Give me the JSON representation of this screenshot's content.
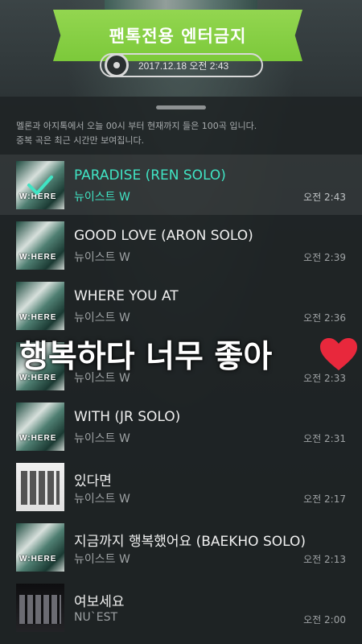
{
  "banner": {
    "label": "팬톡전용 엔터금지"
  },
  "header": {
    "timestamp": "2017.12.18 오전 2:43"
  },
  "notice": {
    "line1": "멜론과 아지톡에서 오늘 00시 부터 현재까지 들은 100곡 입니다.",
    "line2": "중복 곡은 최근 시간만 보여집니다."
  },
  "songs": [
    {
      "title": "PARADISE (REN SOLO)",
      "artist": "뉴이스트 W",
      "time": "오전 2:43",
      "selected": true,
      "art": "where"
    },
    {
      "title": "GOOD LOVE (ARON SOLO)",
      "artist": "뉴이스트 W",
      "time": "오전 2:39",
      "art": "where"
    },
    {
      "title": "WHERE YOU AT",
      "artist": "뉴이스트 W",
      "time": "오전 2:36",
      "art": "where"
    },
    {
      "title": "",
      "artist": "뉴이스트 W",
      "time": "오전 2:33",
      "art": "where"
    },
    {
      "title": "WITH (JR SOLO)",
      "artist": "뉴이스트 W",
      "time": "오전 2:31",
      "art": "where"
    },
    {
      "title": "있다면",
      "artist": "뉴이스트 W",
      "time": "오전 2:17",
      "art": "group"
    },
    {
      "title": "지금까지 행복했어요 (BAEKHO SOLO)",
      "artist": "뉴이스트 W",
      "time": "오전 2:13",
      "art": "where"
    },
    {
      "title": "여보세요",
      "artist": "NU`EST",
      "time": "오전 2:00",
      "art": "dark"
    }
  ],
  "album_art_text": "W:HERE",
  "overlay": {
    "text": "행복하다 너무 좋아"
  },
  "colors": {
    "banner": "#7cc93a",
    "accent": "#40e4c4",
    "heart": "#e8283c"
  },
  "icons": {
    "disc": "disc-icon",
    "check": "check-icon",
    "heart": "heart-icon"
  }
}
